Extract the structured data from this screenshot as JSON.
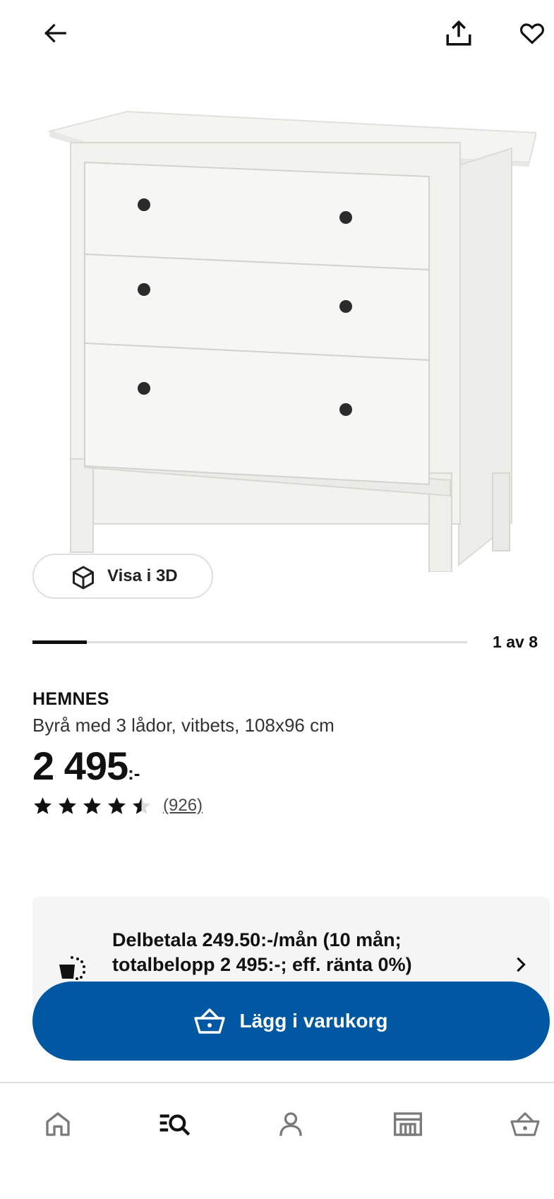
{
  "header": {
    "back_icon": "arrow-left-icon",
    "share_icon": "share-upload-icon",
    "favorite_icon": "heart-outline-icon"
  },
  "gallery": {
    "view_3d_label": "Visa i 3D",
    "view_3d_icon": "cube-icon",
    "progress_fraction": 0.125,
    "page_indicator": "1 av 8"
  },
  "product": {
    "name": "HEMNES",
    "description": "Byrå med 3 lådor, vitbets, 108x96 cm",
    "price_integer": "2 495",
    "price_suffix": ":-",
    "rating_value": 4.5,
    "rating_max": 5,
    "review_count": "(926)"
  },
  "financing": {
    "icon": "installment-coins-icon",
    "text": "Delbetala 249.50:-/mån (10 mån; totalbelopp 2 495:-; eff. ränta 0%)",
    "chevron_icon": "chevron-right-icon"
  },
  "cta": {
    "label": "Lägg i varukorg",
    "icon": "shopping-basket-icon",
    "color": "#0058a3"
  },
  "bottom_nav": {
    "items": [
      {
        "icon": "home-icon"
      },
      {
        "icon": "search-list-icon",
        "active": true
      },
      {
        "icon": "account-icon"
      },
      {
        "icon": "store-icon"
      },
      {
        "icon": "shopping-basket-icon"
      }
    ]
  }
}
